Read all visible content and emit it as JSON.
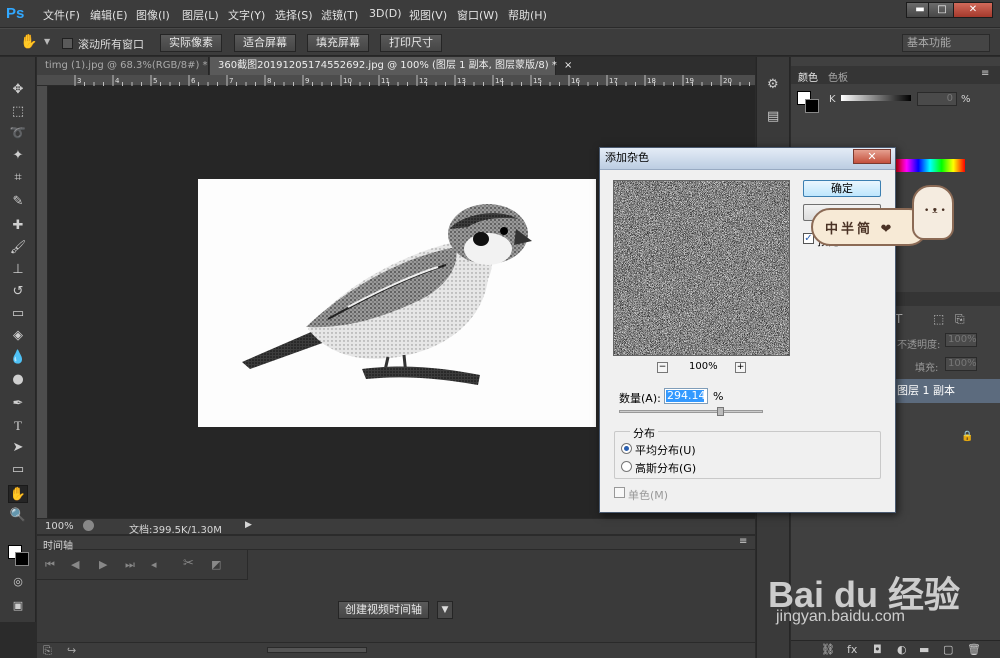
{
  "app": {
    "logo": "Ps",
    "menu": [
      "文件(F)",
      "编辑(E)",
      "图像(I)",
      "图层(L)",
      "文字(Y)",
      "选择(S)",
      "滤镜(T)",
      "3D(D)",
      "视图(V)",
      "窗口(W)",
      "帮助(H)"
    ],
    "window_controls": {
      "minimize": "▬",
      "maximize": "□",
      "close": "✕"
    }
  },
  "options_bar": {
    "scroll_all_label": "滚动所有窗口",
    "buttons": [
      "实际像素",
      "适合屏幕",
      "填充屏幕",
      "打印尺寸"
    ],
    "workspace": "基本功能"
  },
  "tabs": [
    {
      "label": "timg (1).jpg @ 68.3%(RGB/8#) *",
      "close": "×"
    },
    {
      "label": "360截图20191205174552692.jpg @ 100% (图层 1 副本, 图层蒙版/8) *",
      "close": "×"
    }
  ],
  "ruler_marks": [
    "3",
    "4",
    "5",
    "6",
    "7",
    "8",
    "9",
    "10",
    "11",
    "12",
    "13",
    "14",
    "15",
    "16",
    "17",
    "18",
    "19",
    "20"
  ],
  "status": {
    "zoom": "100%",
    "doc_info": "文档:399.5K/1.30M"
  },
  "timeline": {
    "title": "时间轴",
    "create_button": "创建视频时间轴"
  },
  "panels": {
    "color_tabs": [
      "颜色",
      "色板"
    ],
    "k_label": "K",
    "k_value": "0",
    "k_unit": "%",
    "opacity_label": "不透明度:",
    "opacity_value": "100%",
    "fill_label": "填充:",
    "fill_value": "100%",
    "layer_name": "图层 1 副本"
  },
  "dialog": {
    "title": "添加杂色",
    "close": "✕",
    "ok_label": "确定",
    "preview_label": "预览",
    "zoom_value": "100%",
    "amount_label": "数量(A):",
    "amount_value": "294.14",
    "amount_unit": "%",
    "amount_fraction": 0.7,
    "distribution_title": "分布",
    "dist_uniform": "平均分布(U)",
    "dist_gaussian": "高斯分布(G)",
    "monochrome": "单色(M)",
    "selected_distribution": "uniform"
  },
  "sticker": {
    "text": "中半简 ❤"
  },
  "watermark": {
    "logo": "Bai du 经验",
    "url": "jingyan.baidu.com"
  },
  "colors": {
    "accent": "#31a8ff",
    "selection": "#3399ff",
    "layer_active": "#5c6b7e"
  }
}
